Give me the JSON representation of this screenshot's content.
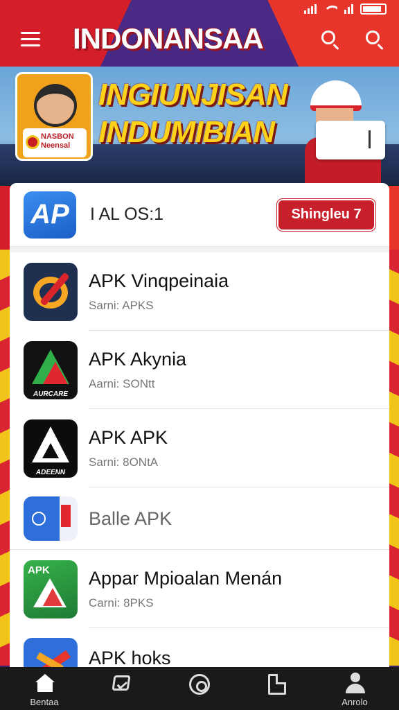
{
  "header": {
    "title": "INDONANSAA"
  },
  "banner": {
    "headline_line1": "INGIUNJISAN",
    "headline_line2": "INDUMIBIAN",
    "badge_line1": "NASBON",
    "badge_line2": "Neensal"
  },
  "featured": {
    "logo_text": "AP",
    "label": "I AL OS:1",
    "button_label": "Shingleu 7"
  },
  "apps": [
    {
      "title": "APK Vinqpeinaia",
      "subtitle": "Sarni: APKS",
      "icon": "target-icon"
    },
    {
      "title": "APK Akynia",
      "subtitle": "Aarni: SONtt",
      "icon": "triangle-logo-icon",
      "icon_caption": "AURCARE"
    },
    {
      "title": "APK APK",
      "subtitle": "Sarni: 8ONtA",
      "icon": "a-logo-icon",
      "icon_caption": "ADEENN"
    },
    {
      "title": "Balle APK",
      "subtitle": "",
      "icon": "blue-app-icon"
    },
    {
      "title": "Appar Mpioalan Menán",
      "subtitle": "Carni: 8PKS",
      "icon": "green-apk-icon",
      "icon_text": "APK"
    },
    {
      "title": "APK hoks",
      "subtitle": "",
      "icon": "x-logo-icon"
    }
  ],
  "bottom_nav": {
    "items": [
      {
        "label": "Bentaa",
        "icon": "home-icon"
      },
      {
        "label": "",
        "icon": "tag-icon"
      },
      {
        "label": "",
        "icon": "target-circle-icon"
      },
      {
        "label": "",
        "icon": "document-icon"
      },
      {
        "label": "Anrolo",
        "icon": "profile-icon"
      }
    ]
  },
  "colors": {
    "brand_red": "#c8202b",
    "accent_yellow": "#ffd21a",
    "purple_bg": "#3b1d6e"
  }
}
